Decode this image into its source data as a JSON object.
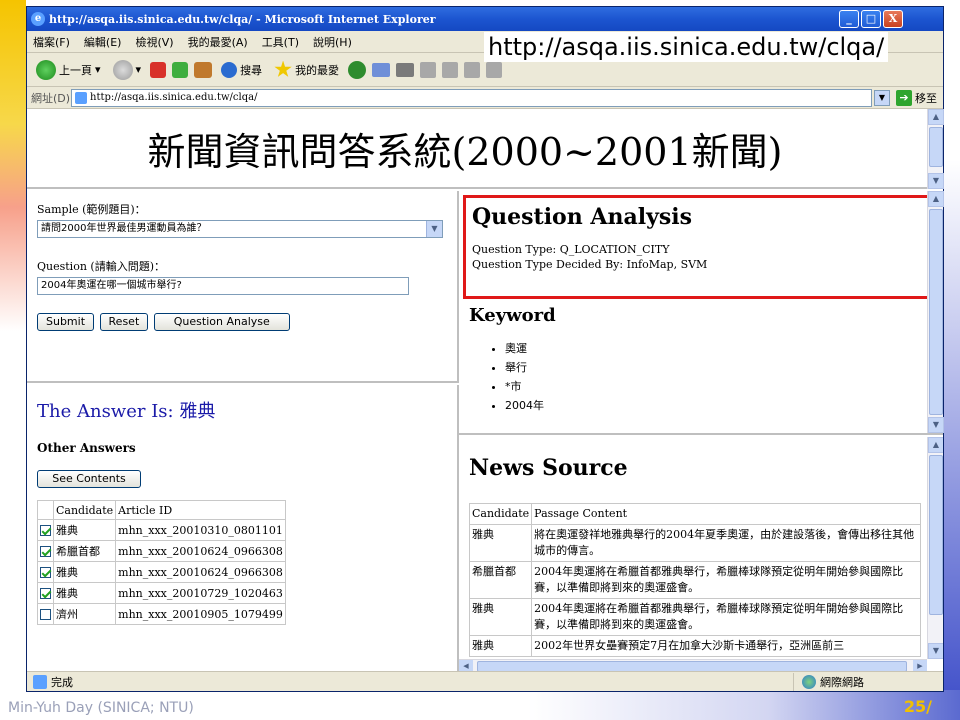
{
  "window": {
    "title": "http://asqa.iis.sinica.edu.tw/clqa/ - Microsoft Internet Explorer",
    "controls": [
      "_",
      "□",
      "X"
    ]
  },
  "url_overlay": "http://asqa.iis.sinica.edu.tw/clqa/",
  "menubar": [
    "檔案(F)",
    "編輯(E)",
    "檢視(V)",
    "我的最愛(A)",
    "工具(T)",
    "說明(H)"
  ],
  "toolbar": {
    "back": "上一頁",
    "search": "搜尋",
    "favorites": "我的最愛"
  },
  "address": {
    "label": "網址(D)",
    "value": "http://asqa.iis.sinica.edu.tw/clqa/",
    "go": "移至"
  },
  "page": {
    "title": "新聞資訊問答系統(2000~2001新聞)"
  },
  "form": {
    "sample_label": "Sample (範例題目)：",
    "sample_value": "請問2000年世界最佳男運動員為誰？",
    "question_label": "Question (請輸入問題)：",
    "question_value": "2004年奧運在哪一個城市舉行?",
    "submit": "Submit",
    "reset": "Reset",
    "analyse": "Question Analyse"
  },
  "answer": {
    "text": "The Answer Is: 雅典",
    "other_answers": "Other Answers",
    "see_contents": "See Contents",
    "headers": [
      "Candidate",
      "Article ID"
    ],
    "rows": [
      {
        "checked": true,
        "candidate": "雅典",
        "article": "mhn_xxx_20010310_0801101"
      },
      {
        "checked": true,
        "candidate": "希臘首都",
        "article": "mhn_xxx_20010624_0966308"
      },
      {
        "checked": true,
        "candidate": "雅典",
        "article": "mhn_xxx_20010624_0966308"
      },
      {
        "checked": true,
        "candidate": "雅典",
        "article": "mhn_xxx_20010729_1020463"
      },
      {
        "checked": false,
        "candidate": "濟州",
        "article": "mhn_xxx_20010905_1079499"
      }
    ]
  },
  "analysis": {
    "heading": "Question Analysis",
    "type_line": "Question Type: Q_LOCATION_CITY",
    "decided_line": "Question Type Decided By: InfoMap, SVM",
    "keyword_heading": "Keyword",
    "keywords": [
      "奧運",
      "舉行",
      "*市",
      "2004年"
    ]
  },
  "news": {
    "heading": "News Source",
    "headers": [
      "Candidate",
      "Passage Content"
    ],
    "rows": [
      {
        "candidate": "雅典",
        "passage": "將在奧運發祥地雅典舉行的2004年夏季奧運，由於建設落後，會傳出移往其他城市的傳言。"
      },
      {
        "candidate": "希臘首都",
        "passage": "2004年奧運將在希臘首都雅典舉行，希臘棒球隊預定從明年開始參與國際比賽，以準備即將到來的奧運盛會。"
      },
      {
        "candidate": "雅典",
        "passage": "2004年奧運將在希臘首都雅典舉行，希臘棒球隊預定從明年開始參與國際比賽，以準備即將到來的奧運盛會。"
      },
      {
        "candidate": "雅典",
        "passage": "2002年世界女壘賽預定7月在加拿大沙斯卡通舉行，亞洲區前三"
      }
    ]
  },
  "status": {
    "left": "完成",
    "zone": "網際網路"
  },
  "slide": {
    "footer_left": "Min-Yuh Day (SINICA; NTU)",
    "page_number": "25"
  }
}
